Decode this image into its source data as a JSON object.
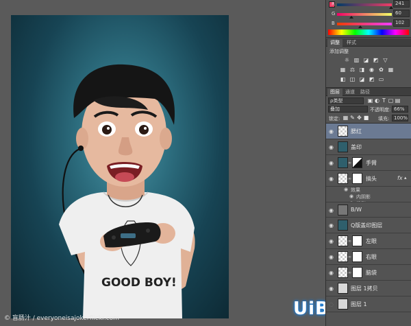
{
  "color_panel": {
    "r_label": "R",
    "r_value": "241",
    "g_label": "G",
    "g_value": "60",
    "b_label": "B",
    "b_value": "102",
    "foreground_color": "#f13c66"
  },
  "adjustments_panel": {
    "tabs": [
      "调整",
      "样式"
    ],
    "add_label": "添加调整"
  },
  "layers_panel": {
    "tabs": [
      "图层",
      "通道",
      "路径"
    ],
    "kind_filter": "ρ类型",
    "blend_mode": "叠加",
    "opacity_label": "不透明度:",
    "opacity_value": "66%",
    "lock_label": "锁定:",
    "fill_label": "填充:",
    "fill_value": "100%",
    "layers": [
      {
        "name": "腮红",
        "selected": true
      },
      {
        "name": "盖印"
      },
      {
        "name": "手臂"
      },
      {
        "name": "搞头",
        "fx": "fx"
      },
      {
        "name": "B/W"
      },
      {
        "name": "Q版盖印图层"
      },
      {
        "name": "左眼"
      },
      {
        "name": "右眼"
      },
      {
        "name": "脑袋"
      },
      {
        "name": "图层 1拷贝"
      },
      {
        "name": "图层 1"
      }
    ],
    "effects": {
      "title": "效果",
      "items": [
        "内阴影",
        "投影"
      ]
    }
  },
  "photo": {
    "shirt_text": "GOOD BOY!"
  },
  "watermarks": {
    "left": "© 盲肠汁 / everyoneisajokerflickr.com",
    "logo": "UiBQ.CoM"
  }
}
